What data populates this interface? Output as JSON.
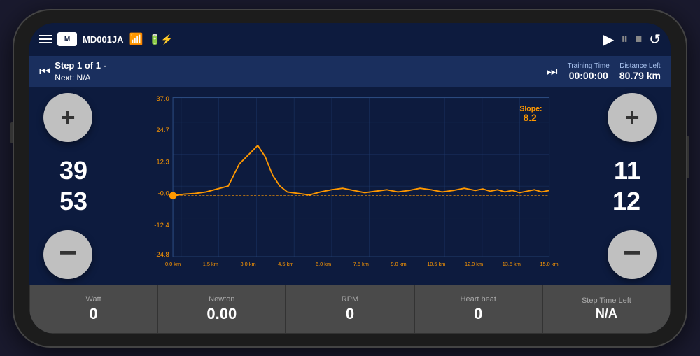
{
  "phone": {
    "header": {
      "device_id": "MD001JA",
      "wifi_icon": "wifi",
      "battery_icon": "battery",
      "play_label": "▶",
      "pause_label": "⏸",
      "stop_label": "⏹",
      "refresh_label": "↺"
    },
    "step_bar": {
      "step_text_line1": "Step 1 of 1 -",
      "step_text_line2": "Next: N/A",
      "training_time_label": "Training Time",
      "training_time_value": "00:00:00",
      "distance_left_label": "Distance Left",
      "distance_left_value": "80.79 km"
    },
    "left_panel": {
      "plus_label": "+",
      "minus_label": "−",
      "value1": "39",
      "value2": "53"
    },
    "right_panel": {
      "plus_label": "+",
      "minus_label": "−",
      "value1": "11",
      "value2": "12"
    },
    "chart": {
      "slope_label": "Slope:",
      "slope_value": "8.2",
      "y_axis": [
        "37.0",
        "24.7",
        "12.3",
        "-0.0",
        "-12.4",
        "-24.8"
      ],
      "x_axis": [
        "0.0 km",
        "1.5 km",
        "3.0 km",
        "4.5 km",
        "6.0 km",
        "7.5 km",
        "9.0 km",
        "10.5 km",
        "12.0 km",
        "13.5 km",
        "15.0 km"
      ]
    },
    "bottom_tiles": [
      {
        "label": "Watt",
        "value": "0"
      },
      {
        "label": "Newton",
        "value": "0.00"
      },
      {
        "label": "RPM",
        "value": "0"
      },
      {
        "label": "Heart beat",
        "value": "0"
      },
      {
        "label": "Step Time Left",
        "value": "N/A"
      }
    ]
  }
}
